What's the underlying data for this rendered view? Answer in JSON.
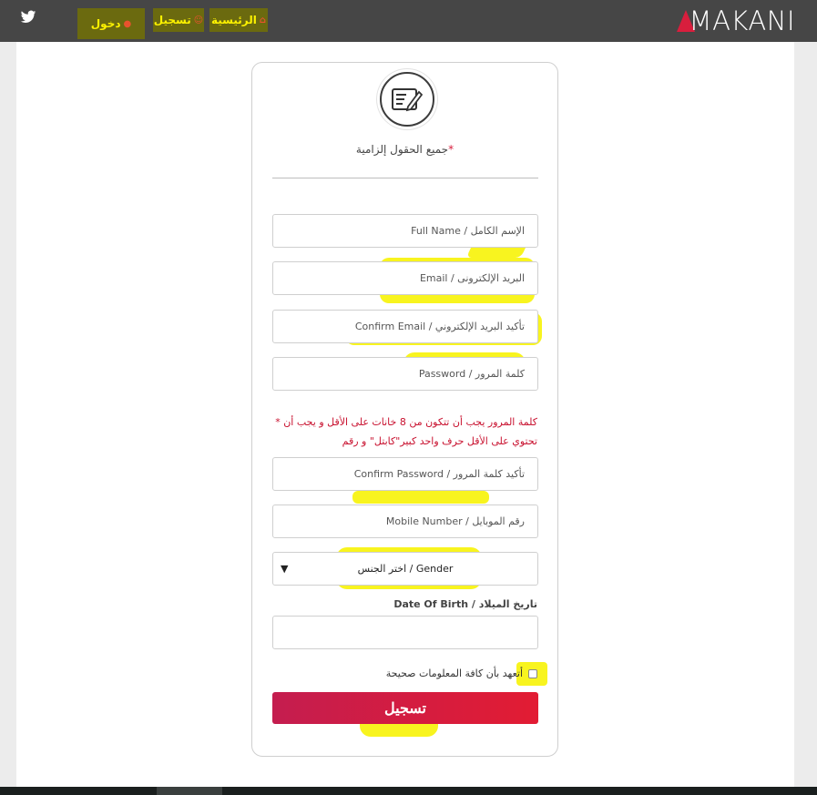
{
  "brand": {
    "logo_text": "MAKANI",
    "accent": "#d81e3d"
  },
  "nav": {
    "home": "الرئيسية",
    "register": "تسجيل",
    "login": "دخول"
  },
  "form": {
    "required_star": "*",
    "required_note": "جميع الحقول إلزامية",
    "full_name": "الإسم الكامل / Full Name",
    "email": "البريد الإلكترونى / Email",
    "confirm_email": "تأكيد البريد الإلكتروني / Confirm Email",
    "password": "كلمة المرور / Password",
    "password_rule_1": "كلمة المرور يجب أن تتكون من 8 خانات على الأقل و يجب أن *",
    "password_rule_2": "تحتوي على الأقل حرف واحد كبير\"كابتل\" و رقم",
    "confirm_password": "تأكيد كلمة المرور / Confirm Password",
    "mobile": "رقم الموبايل / Mobile Number",
    "gender_selected": "Gender / اختر الجنس",
    "gender_arrow": "▼",
    "dob_label": "تاريخ الميلاد / Date Of Birth",
    "agree_label": "أتعهد بأن كافة المعلومات صحيحة",
    "submit_label": "تسجيل"
  }
}
